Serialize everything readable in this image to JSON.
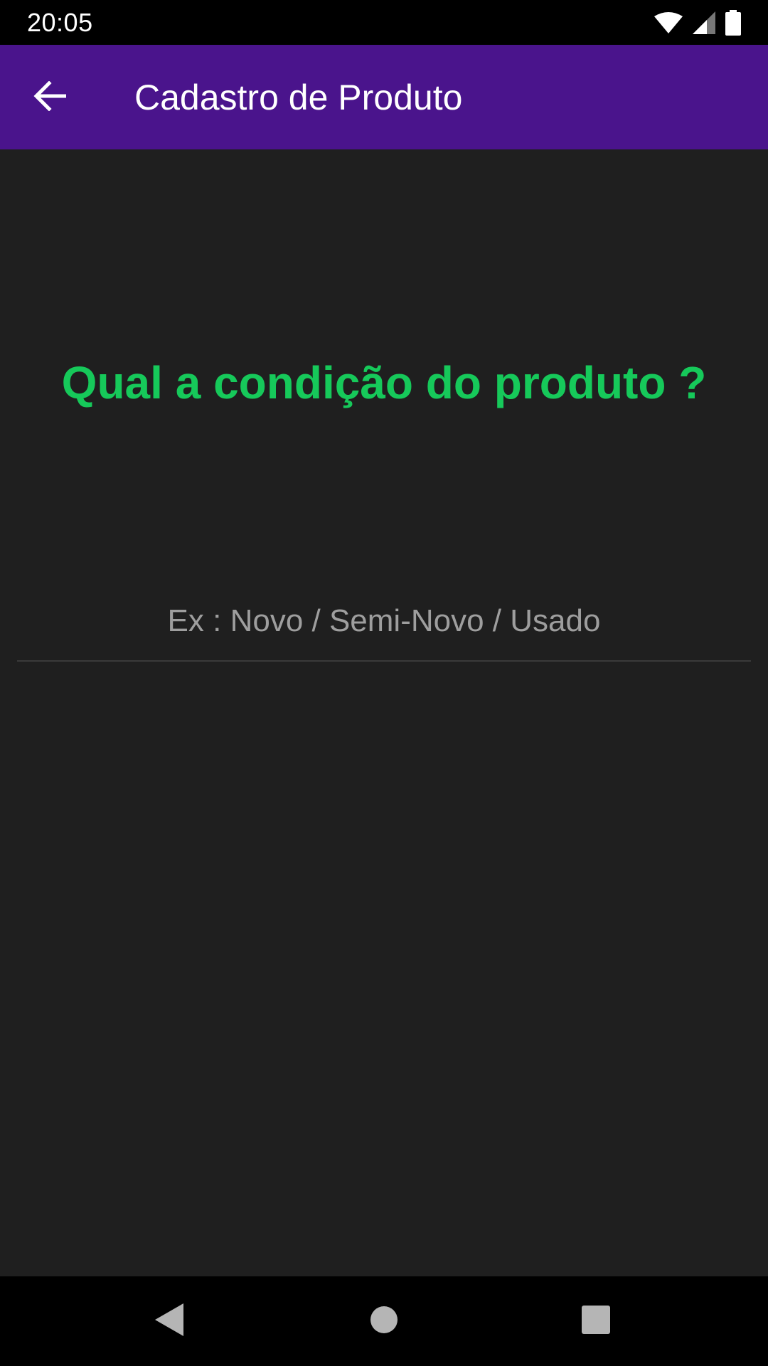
{
  "status_bar": {
    "time": "20:05",
    "icons": [
      "wifi-icon",
      "cellular-signal-icon",
      "battery-icon"
    ]
  },
  "app_bar": {
    "title": "Cadastro de Produto",
    "back_icon": "arrow-back-icon",
    "background_color": "#4a148c"
  },
  "content": {
    "question": "Qual a condição do produto ?",
    "question_color": "#16c95a",
    "condition_input": {
      "value": "",
      "placeholder": "Ex : Novo / Semi-Novo / Usado"
    }
  },
  "nav_bar": {
    "buttons": [
      "nav-back-icon",
      "nav-home-icon",
      "nav-recents-icon"
    ]
  }
}
